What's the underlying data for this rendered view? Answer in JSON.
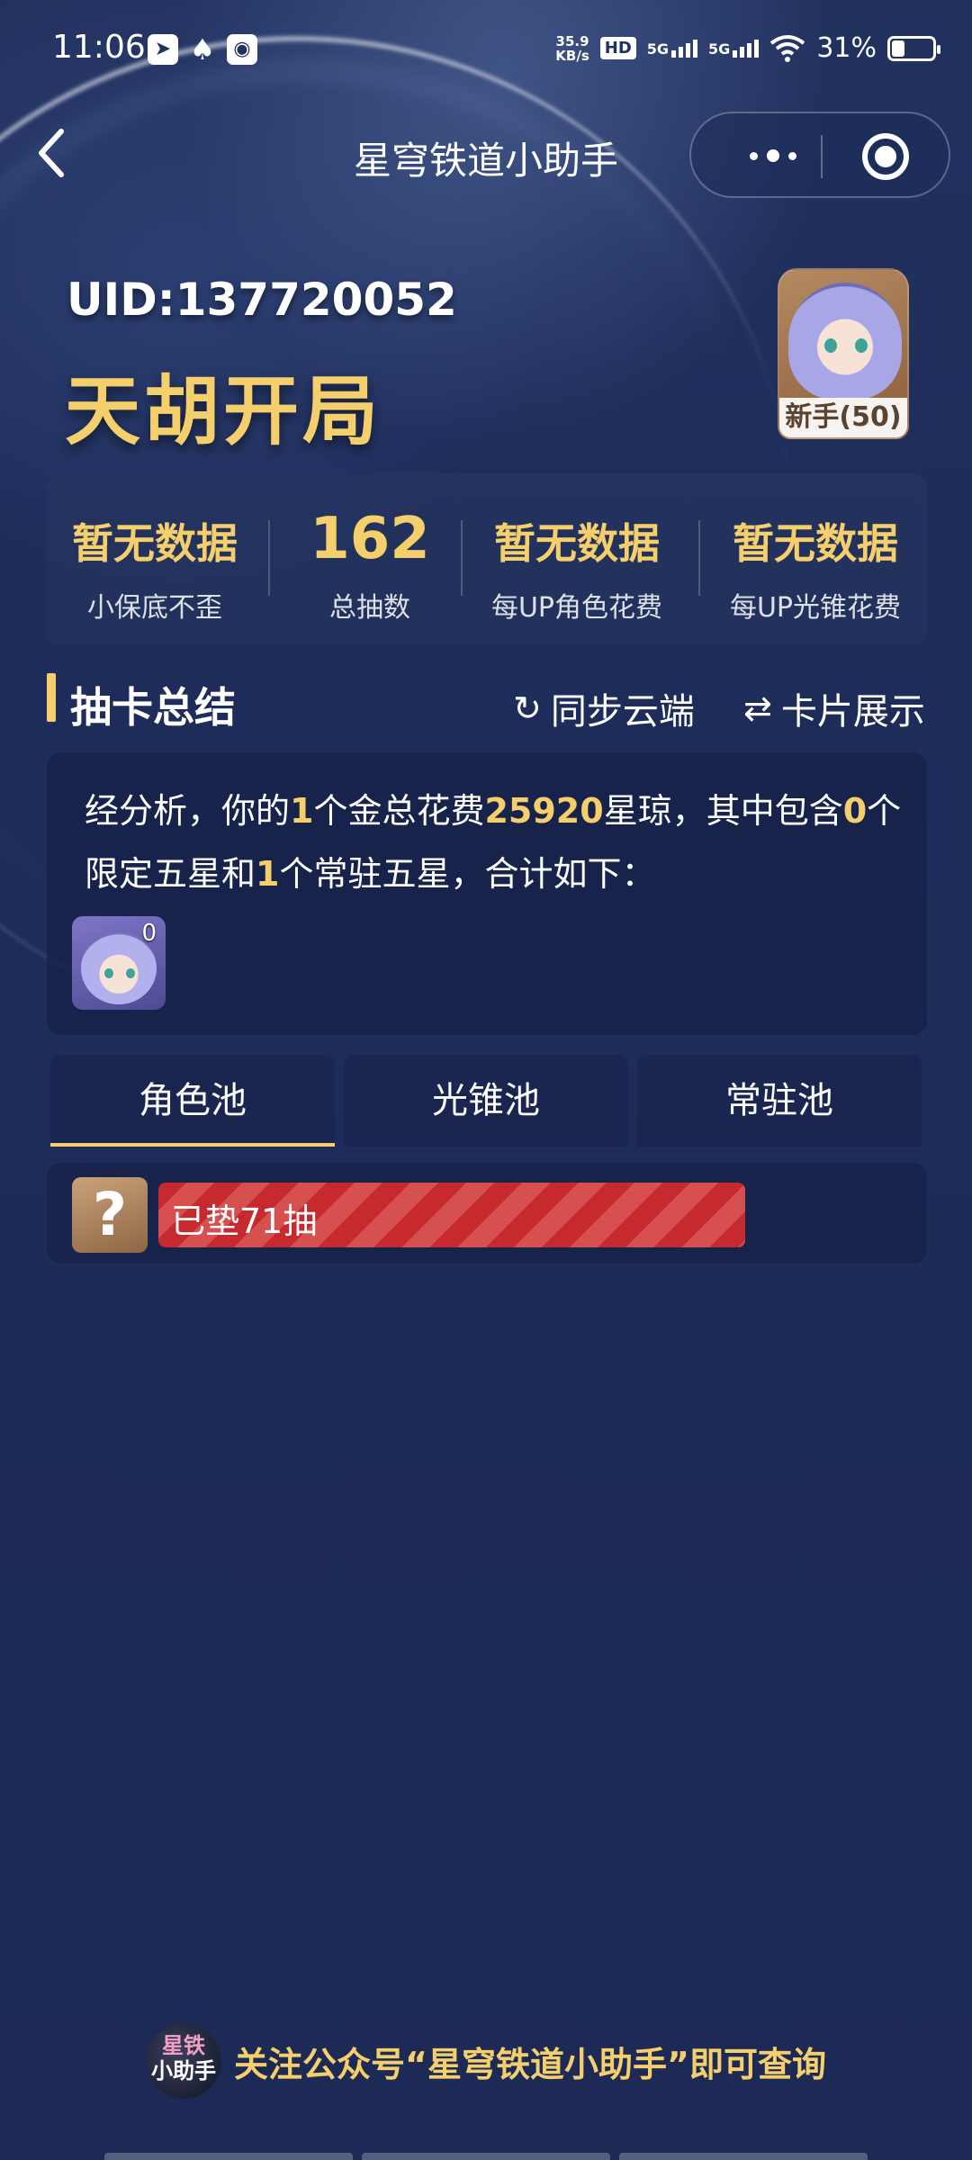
{
  "status_bar": {
    "time": "11:06",
    "net_speed_value": "35.9",
    "net_speed_unit": "KB/s",
    "hd_label": "HD",
    "sim1_label": "5G",
    "sim2_label": "5G",
    "battery_text": "31%",
    "battery_level": 0.31
  },
  "nav": {
    "title": "星穹铁道小助手"
  },
  "header": {
    "uid": "UID:137720052",
    "title": "天胡开局",
    "avatar_label": "新手(50)"
  },
  "stats": [
    {
      "value": "暂无数据",
      "label": "小保底不歪"
    },
    {
      "value": "162",
      "label": "总抽数"
    },
    {
      "value": "暂无数据",
      "label": "每UP角色花费"
    },
    {
      "value": "暂无数据",
      "label": "每UP光锥花费"
    }
  ],
  "section": {
    "title": "抽卡总结",
    "sync_label": "同步云端",
    "cards_label": "卡片展示"
  },
  "summary": {
    "p1": "经分析，你的",
    "gold_count": "1",
    "p2": "个金总花费",
    "cost": "25920",
    "p3": "星琼，其中包含",
    "limited_count": "0",
    "p4": "个限定五星和",
    "standard_count": "1",
    "p5": "个常驻五星，合计如下：",
    "character_count": "0"
  },
  "tabs": [
    {
      "label": "角色池",
      "active": true
    },
    {
      "label": "光锥池",
      "active": false
    },
    {
      "label": "常驻池",
      "active": false
    }
  ],
  "pool": {
    "unknown_icon": "?",
    "pity_text": "已垫71抽"
  },
  "footer": {
    "logo_line1": "星铁",
    "logo_line2": "小助手",
    "text": "关注公众号“星穹铁道小助手”即可查询"
  },
  "colors": {
    "accent_gold": "#f5cf6c",
    "background": "#1e2d5a",
    "pity_bar": "#c62a2e"
  }
}
